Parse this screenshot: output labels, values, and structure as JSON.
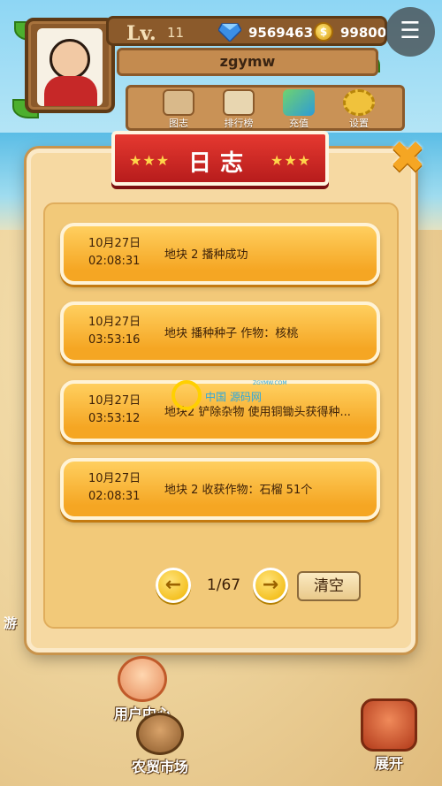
{
  "player": {
    "level_label": "Lv.",
    "level": "11",
    "gems": "9569463",
    "coin_symbol": "$",
    "coins": "99800",
    "username": "zgymw"
  },
  "menu": [
    {
      "label": "图志",
      "icon": "book-icon"
    },
    {
      "label": "排行榜",
      "icon": "ranking-icon"
    },
    {
      "label": "充值",
      "icon": "crystal-icon"
    },
    {
      "label": "设置",
      "icon": "gear-icon"
    }
  ],
  "hamburger": {
    "glyph": "☰"
  },
  "dialog": {
    "title": "日志",
    "stars_left": "★★★",
    "stars_right": "★★★",
    "close_glyph": "✖"
  },
  "logs": [
    {
      "date": "10月27日",
      "time": "02:08:31",
      "text": "地块 2 播种成功"
    },
    {
      "date": "10月27日",
      "time": "03:53:16",
      "text": "地块 播种种子 作物：核桃"
    },
    {
      "date": "10月27日",
      "time": "03:53:12",
      "text": "地块2 铲除杂物 使用铜锄头获得种..."
    },
    {
      "date": "10月27日",
      "time": "02:08:31",
      "text": "地块 2 收获作物：石榴 51个"
    }
  ],
  "pagination": {
    "prev_glyph": "←",
    "next_glyph": "→",
    "page_text": "1/67",
    "clear_label": "清空"
  },
  "watermark": {
    "cn": "中国 源码网",
    "url": "ZGYMW.COM"
  },
  "bottom": {
    "user_center": "用户中心",
    "market": "农贸市场",
    "expand": "展开",
    "side_label": "游"
  },
  "colors": {
    "banner_red": "#d32f2f",
    "card_orange": "#f5a623",
    "dialog_bg": "#f6d9a2"
  }
}
